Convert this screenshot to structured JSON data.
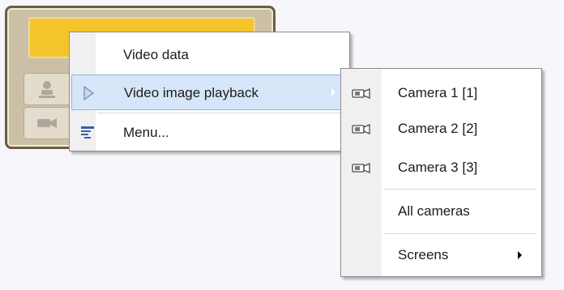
{
  "main_menu": {
    "items": [
      {
        "label": "Video data",
        "icon": null
      },
      {
        "label": "Video image playback",
        "icon": "play-icon",
        "submenu": true,
        "highlighted": true
      },
      {
        "label": "Menu...",
        "icon": "menu-list-icon"
      }
    ]
  },
  "submenu": {
    "items": [
      {
        "label": "Camera 1 [1]",
        "icon": "camera-icon"
      },
      {
        "label": "Camera 2 [2]",
        "icon": "camera-icon"
      },
      {
        "label": "Camera 3 [3]",
        "icon": "camera-icon"
      },
      {
        "label": "All cameras",
        "icon": null
      },
      {
        "label": "Screens",
        "icon": null,
        "submenu": true
      }
    ]
  },
  "colors": {
    "panel_bar": "#f3c52a",
    "highlight": "#d6e6f8",
    "highlight_border": "#8fb5e4"
  }
}
